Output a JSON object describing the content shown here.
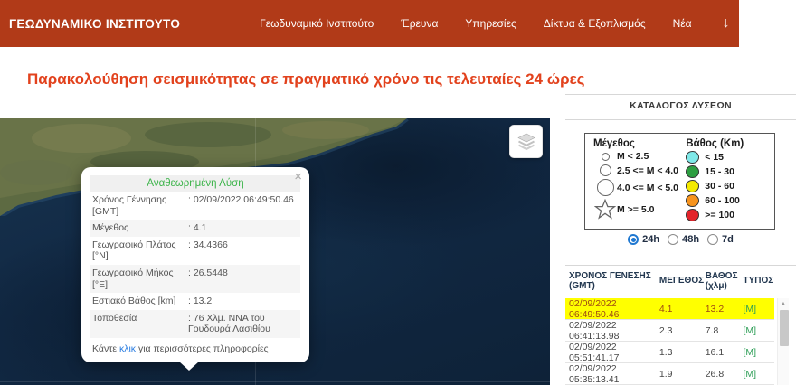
{
  "header": {
    "logo": "ΓΕΩΔΥΝΑΜΙΚΟ ΙΝΣΤΙΤΟΥΤΟ",
    "nav": [
      {
        "label": "Γεωδυναμικό Ινστιτούτο"
      },
      {
        "label": "Έρευνα"
      },
      {
        "label": "Υπηρεσίες"
      },
      {
        "label": "Δίκτυα & Εξοπλισμός"
      },
      {
        "label": "Νέα"
      }
    ],
    "down_arrow": "↓"
  },
  "page_title": "Παρακολούθηση σεισμικότητας σε πραγματικό χρόνο τις τελευταίες 24 ώρες",
  "map": {
    "popup": {
      "title": "Αναθεωρημένη Λύση",
      "close": "×",
      "rows": [
        {
          "label": "Χρόνος Γέννησης [GMT]",
          "value": ": 02/09/2022 06:49:50.46"
        },
        {
          "label": "Μέγεθος",
          "value": ": 4.1"
        },
        {
          "label": "Γεωγραφικό Πλάτος [°N]",
          "value": ": 34.4366"
        },
        {
          "label": "Γεωγραφικό Μήκος [°E]",
          "value": ": 26.5448"
        },
        {
          "label": "Εστιακό Βάθος [km]",
          "value": ": 13.2"
        },
        {
          "label": "Τοποθεσία",
          "value": ": 76 Χλμ. ΝΝΑ του Γουδουρά Λασιθίου"
        }
      ],
      "footer_prefix": "Κάντε ",
      "footer_link": "κλικ",
      "footer_suffix": " για περισσότερες πληροφορίες"
    }
  },
  "sidebar": {
    "catalog_title": "ΚΑΤΑΛΟΓΟΣ ΛΥΣΕΩΝ",
    "legend": {
      "magnitude_title": "Μέγεθος",
      "magnitude_items": [
        {
          "label": "M < 2.5"
        },
        {
          "label": "2.5 <= M < 4.0"
        },
        {
          "label": "4.0 <= M < 5.0"
        },
        {
          "label": "M >= 5.0"
        }
      ],
      "depth_title": "Βάθος (Km)",
      "depth_items": [
        {
          "label": "< 15",
          "color": "#7fe9e9"
        },
        {
          "label": "15 - 30",
          "color": "#2d9e41"
        },
        {
          "label": "30 - 60",
          "color": "#f5ea00"
        },
        {
          "label": "60 - 100",
          "color": "#f7941e"
        },
        {
          "label": ">= 100",
          "color": "#e3242b"
        }
      ]
    },
    "time_filters": [
      {
        "label": "24h",
        "selected": true
      },
      {
        "label": "48h",
        "selected": false
      },
      {
        "label": "7d",
        "selected": false
      }
    ],
    "table": {
      "headers": [
        "ΧΡΟΝΟΣ ΓΕΝΕΣΗΣ (GMT)",
        "ΜΕΓΕΘΟΣ",
        "ΒΑΘΟΣ (χλμ)",
        "ΤΥΠΟΣ"
      ],
      "rows": [
        {
          "time": "02/09/2022 06:49:50.46",
          "magnitude": "4.1",
          "depth": "13.2",
          "type": "[M]",
          "highlighted": true
        },
        {
          "time": "02/09/2022 06:41:13.98",
          "magnitude": "2.3",
          "depth": "7.8",
          "type": "[M]",
          "highlighted": false
        },
        {
          "time": "02/09/2022 05:51:41.17",
          "magnitude": "1.3",
          "depth": "16.1",
          "type": "[M]",
          "highlighted": false
        },
        {
          "time": "02/09/2022 05:35:13.41",
          "magnitude": "1.9",
          "depth": "26.8",
          "type": "[M]",
          "highlighted": false
        }
      ]
    }
  },
  "colors": {
    "header_bg": "#b13a18",
    "page_title": "#e2421d",
    "highlight_row_bg": "#ffff00",
    "type_link_green": "#2e9e57",
    "popup_title_green": "#3cb44a",
    "marker_teal": "#38afbc",
    "link_blue": "#2a7de1"
  }
}
